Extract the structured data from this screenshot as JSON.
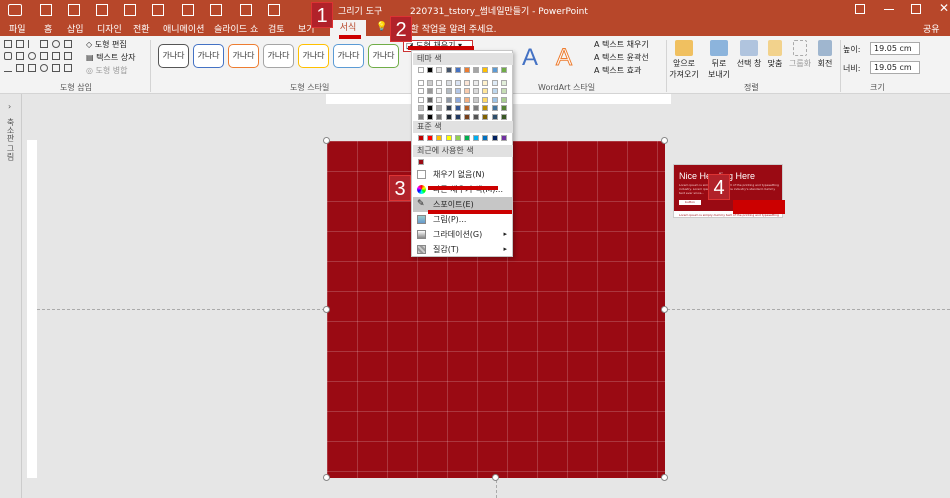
{
  "title_bar": {
    "context_tab": "그리기 도구",
    "file_title": "220731_tstory_썸네일만들기 - PowerPoint",
    "share": "공유"
  },
  "tabs": [
    "파일",
    "홈",
    "삽입",
    "디자인",
    "전환",
    "애니메이션",
    "슬라이드 쇼",
    "검토",
    "보기",
    "서식"
  ],
  "tell_me": "수행할 작업을 알려 주세요.",
  "ribbon": {
    "insert_shapes": {
      "edit_shape": "도형 편집",
      "text_box": "텍스트 상자",
      "merge_shapes": "도형 병합",
      "label": "도형 삽입"
    },
    "shape_styles": {
      "style_sample": "가나다",
      "fill_button": "도형 채우기",
      "label": "도형 스타일"
    },
    "wordart": {
      "text_fill": "텍스트 채우기",
      "text_outline": "텍스트 윤곽선",
      "text_effects": "텍스트 효과",
      "label": "WordArt 스타일",
      "glyph": "A"
    },
    "arrange": {
      "bring_forward": "앞으로\n가져오기",
      "send_backward": "뒤로\n보내기",
      "selection_pane": "선택 창",
      "align": "맞춤",
      "group": "그룹화",
      "rotate": "회전",
      "label": "정렬"
    },
    "size": {
      "height_label": "높이:",
      "height": "19.05 cm",
      "width_label": "너비:",
      "width": "19.05 cm",
      "label": "크기"
    }
  },
  "thumb_panel_label": "축소판 그림",
  "dropdown": {
    "theme_colors_header": "테마 색",
    "standard_colors_header": "표준 색",
    "recent_colors_header": "최근에 사용한 색",
    "items": [
      {
        "label": "채우기 없음(N)",
        "icon": "no-fill-icon"
      },
      {
        "label": "다른 채우기 색(M)...",
        "icon": "color-wheel-icon"
      },
      {
        "label": "스포이트(E)",
        "icon": "eyedropper-icon"
      },
      {
        "label": "그림(P)...",
        "icon": "picture-icon"
      },
      {
        "label": "그라데이션(G)",
        "icon": "gradient-icon",
        "submenu": true
      },
      {
        "label": "질감(T)",
        "icon": "texture-icon",
        "submenu": true
      }
    ],
    "theme_colors": [
      "#ffffff",
      "#000000",
      "#e7e6e6",
      "#44546a",
      "#4472c4",
      "#ed7d31",
      "#a5a5a5",
      "#ffc000",
      "#5b9bd5",
      "#70ad47"
    ],
    "standard_colors": [
      "#c00000",
      "#ff0000",
      "#ffc000",
      "#ffff00",
      "#92d050",
      "#00b050",
      "#00b0f0",
      "#0070c0",
      "#002060",
      "#7030a0"
    ],
    "recent_colors": [
      "#9a0a13"
    ]
  },
  "thumbnail": {
    "title": "Nice Heading Here",
    "body": "Lorem ipsum is simply dummy text of the printing and typesetting industry. Lorem ipsum has been the industry's standard dummy text ever since...",
    "button": "button",
    "footer": "Lorem ipsum is simply dummy text of the printing and typesetting"
  },
  "step_badges": [
    "1",
    "2",
    "3",
    "4"
  ],
  "colors": {
    "accent": "#b7472a",
    "slide_fill": "#9a0a13",
    "badge": "#b1222a"
  }
}
